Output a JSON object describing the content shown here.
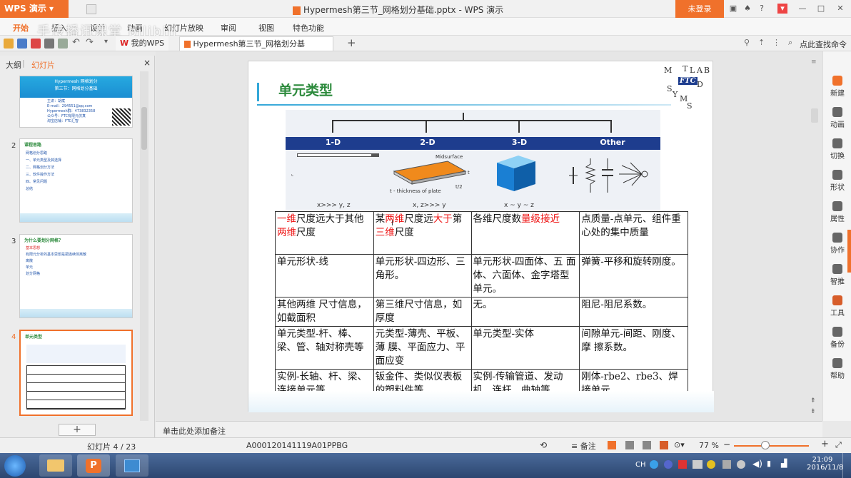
{
  "titlebar": {
    "app_name": "WPS 演示",
    "doc_title": "Hypermesh第三节_网格划分基础.pptx - WPS 演示",
    "login": "未登录"
  },
  "ribbon": {
    "tabs": [
      "开始",
      "插入",
      "设计",
      "动画",
      "幻灯片放映",
      "审阅",
      "视图",
      "特色功能"
    ],
    "watermark": "手传播讯课堂 bilibili"
  },
  "doc_tabs": {
    "wps": "我的WPS",
    "file": "Hypermesh第三节_网格划分基础.pptx",
    "add": "+",
    "search": "点此查找命令"
  },
  "left_panel": {
    "tab_outline": "大纲",
    "tab_slides": "幻灯片",
    "close": "×",
    "thumbs": [
      {
        "num": "",
        "title": "Hypermesh 网格划分",
        "sub": "第三节：网格划分基础",
        "lines": [
          "主讲：胡斌",
          "E-mail：294551@qq.com",
          "Hypermesh群：473832358",
          "公众号：FTC有限元仿真",
          "淘宝店铺：FTC汇智"
        ]
      },
      {
        "num": "2",
        "title": "课程思路",
        "lines": [
          "网格划分思路",
          "一、单元类型及其选择",
          "二、网格划分方法",
          "三、软件操作方法",
          "四、常见问题",
          "总结"
        ]
      },
      {
        "num": "3",
        "title": "为什么要划分网格？",
        "lines": [
          "基本思想",
          "有限元分析的基本思想是把连续体离散",
          "离散",
          "单元",
          "划分网格"
        ]
      },
      {
        "num": "4",
        "title": "单元类型"
      }
    ],
    "add_btn": "+"
  },
  "slide": {
    "title": "单元类型",
    "logo_letters": [
      "M",
      "T",
      "L",
      "A",
      "B",
      "F",
      "T",
      "C",
      "S",
      "Y",
      "M",
      "D",
      "S"
    ],
    "categories": [
      "1-D",
      "2-D",
      "3-D",
      "Other"
    ],
    "diagram_labels": {
      "midsurface": "Midsurface",
      "thickness": "t - thickness of plate",
      "t": "t",
      "t2": "t/2",
      "rel_1d": "x>>> y, z",
      "rel_2d": "x, z>>> y",
      "rel_3d": "x ~ y ~ z"
    },
    "table": [
      [
        [
          {
            "t": "一维",
            "r": true
          },
          {
            "t": "尺度远大于其他"
          },
          {
            "t": "两维",
            "r": true
          },
          {
            "t": "尺度"
          }
        ],
        [
          {
            "t": "某"
          },
          {
            "t": "两维",
            "r": true
          },
          {
            "t": "尺度远"
          },
          {
            "t": "大于",
            "r": true
          },
          {
            "t": "第"
          },
          {
            "t": "三维",
            "r": true
          },
          {
            "t": "尺度"
          }
        ],
        [
          {
            "t": "各维尺度数"
          },
          {
            "t": "量级接近",
            "r": true
          }
        ],
        [
          {
            "t": "点质量-点单元、组件重心处的集中质量"
          }
        ]
      ],
      [
        [
          {
            "t": "单元形状-线"
          }
        ],
        [
          {
            "t": "单元形状-四边形、三角形。"
          }
        ],
        [
          {
            "t": "单元形状-四面体、五 面体、六面体、金字塔型单元。"
          }
        ],
        [
          {
            "t": "弹簧-平移和旋转刚度。"
          }
        ]
      ],
      [
        [
          {
            "t": "其他两维 尺寸信息，如截面积"
          }
        ],
        [
          {
            "t": "第三维尺寸信息，如厚度"
          }
        ],
        [
          {
            "t": "无。"
          }
        ],
        [
          {
            "t": "阻尼-阻尼系数。"
          }
        ]
      ],
      [
        [
          {
            "t": "单元类型-杆、棒、梁、管、轴对称壳等"
          }
        ],
        [
          {
            "t": "元类型-薄壳、平板、薄 膜、平面应力、平面应变"
          }
        ],
        [
          {
            "t": "单元类型-实体"
          }
        ],
        [
          {
            "t": "间隙单元-间距、刚度、摩 擦系数。"
          }
        ]
      ],
      [
        [
          {
            "t": "实例-长轴、杆、梁、连接单元等"
          }
        ],
        [
          {
            "t": "钣金件、类似仪表板 的塑料件等"
          }
        ],
        [
          {
            "t": "实例-传输管道、发动机、连杆、曲轴等"
          }
        ],
        [
          {
            "t": "刚体-rbe2、rbe3、焊接单元"
          }
        ]
      ]
    ]
  },
  "right_bar": [
    "新建",
    "动画",
    "切换",
    "形状",
    "属性",
    "协作",
    "智推",
    "工具",
    "备份",
    "帮助"
  ],
  "notes": "单击此处添加备注",
  "status": {
    "slide_count": "幻灯片 4 / 23",
    "doc_id": "A000120141119A01PPBG",
    "notes_btn": "备注",
    "zoom": "77 %"
  },
  "taskbar": {
    "time": "21:09",
    "date": "2016/11/8",
    "lang": "CH"
  },
  "colors": {
    "wps_orange": "#f0712b",
    "slide_green": "#2c8a3c",
    "header_blue": "#1e3d8e",
    "red_text": "#e11111"
  }
}
